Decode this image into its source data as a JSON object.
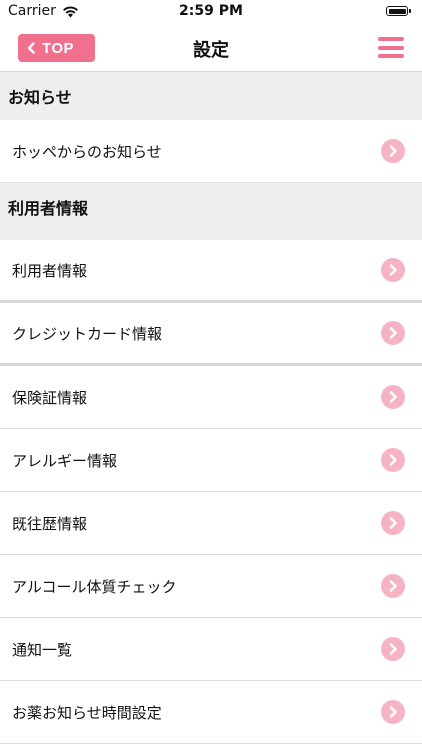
{
  "status_bar": {
    "carrier": "Carrier",
    "time": "2:59 PM"
  },
  "nav": {
    "back_label": "TOP",
    "title": "設定",
    "accent_color": "#f0708e"
  },
  "sections": [
    {
      "header": "お知らせ",
      "items": [
        "ホッペからのお知らせ"
      ]
    },
    {
      "header": "利用者情報",
      "items": [
        "利用者情報",
        "クレジットカード情報",
        "保険証情報",
        "アレルギー情報",
        "既往歴情報",
        "アルコール体質チェック",
        "通知一覧",
        "お薬お知らせ時間設定"
      ]
    }
  ]
}
